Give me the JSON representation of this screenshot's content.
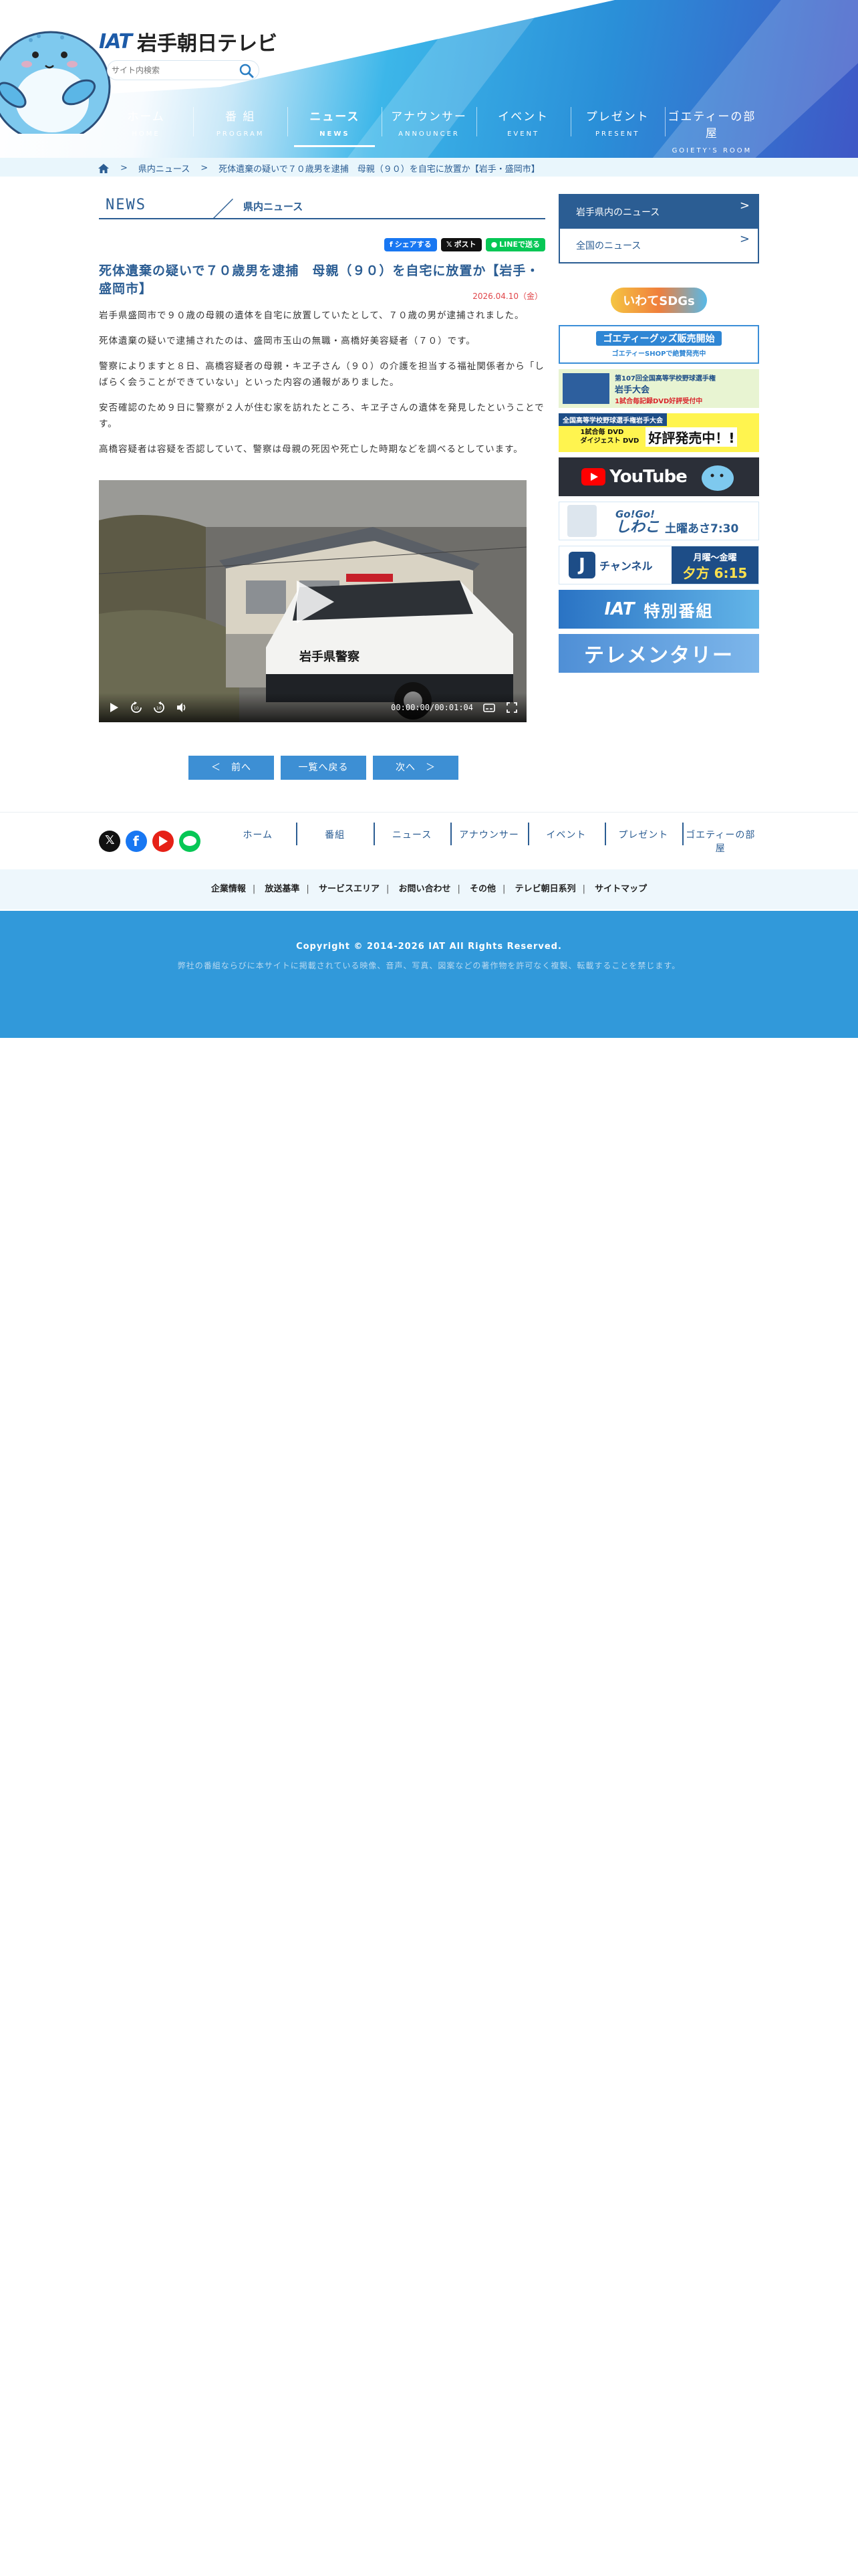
{
  "header": {
    "logo_mark": "IAT",
    "logo_text": "岩手朝日テレビ",
    "search_placeholder": "サイト内検索"
  },
  "gnav": [
    {
      "jp": "ホーム",
      "en": "HOME"
    },
    {
      "jp": "番 組",
      "en": "PROGRAM"
    },
    {
      "jp": "ニュース",
      "en": "NEWS"
    },
    {
      "jp": "アナウンサー",
      "en": "ANNOUNCER"
    },
    {
      "jp": "イベント",
      "en": "EVENT"
    },
    {
      "jp": "プレゼント",
      "en": "PRESENT"
    },
    {
      "jp": "ゴエティーの部屋",
      "en": "GOIETY'S ROOM"
    }
  ],
  "breadcrumb": {
    "sep": ">",
    "level1": "県内ニュース",
    "level2": "死体遺棄の疑いで７０歳男を逮捕　母親（９０）を自宅に放置か【岩手・盛岡市】"
  },
  "article": {
    "section_en": "NEWS",
    "section_slash": "／",
    "section_cat": "県内ニュース",
    "share_fb": "シェアする",
    "share_x": "ポスト",
    "share_line": "LINEで送る",
    "title": "死体遺棄の疑いで７０歳男を逮捕　母親（９０）を自宅に放置か【岩手・盛岡市】",
    "date": "2026.04.10（金）",
    "paragraphs": [
      "岩手県盛岡市で９０歳の母親の遺体を自宅に放置していたとして、７０歳の男が逮捕されました。",
      "死体遺棄の疑いで逮捕されたのは、盛岡市玉山の無職・高橋好美容疑者（７０）です。",
      "警察によりますと８日、高橋容疑者の母親・キヱ子さん（９０）の介護を担当する福祉関係者から「しばらく会うことができていない」といった内容の通報がありました。",
      "安否確認のため９日に警察が２人が住む家を訪れたところ、キヱ子さんの遺体を発見したということです。",
      "高橋容疑者は容疑を否認していて、警察は母親の死因や死亡した時期などを調べるとしています。"
    ],
    "video_time": "00:00:00/00:01:04",
    "video_car_text": "岩手県警察"
  },
  "pager": {
    "prev": "＜　前へ",
    "list": "一覧へ戻る",
    "next": "次へ　＞"
  },
  "sidebar": {
    "tab_local": "岩手県内のニュース",
    "tab_national": "全国のニュース",
    "arrow": ">",
    "banners": {
      "b1": "いわてSDGs",
      "b2a": "ゴエティーグッズ販売開始",
      "b2b": "ゴエティーSHOPで絶賛発売中",
      "b3a": "第107回全国高等学校野球選手権",
      "b3b": "岩手大会",
      "b3c": "1試合毎記録DVD好評受付中",
      "b4a": "全国高等学校野球選手権岩手大会",
      "b4b": "1試合毎 DVD",
      "b4c": "ダイジェスト DVD",
      "b4d": "好評発売中！!",
      "b5": "YouTube",
      "b6a": "Go!Go!",
      "b6b": "しわこ",
      "b6c": "土曜あさ7:30",
      "b7a": "チャンネル",
      "b7b": "月曜～金曜",
      "b7c": "夕方 6:15",
      "b8": "特別番組",
      "b9": "テレメンタリー"
    }
  },
  "footer_nav": [
    "ホーム",
    "番組",
    "ニュース",
    "アナウンサー",
    "イベント",
    "プレゼント",
    "ゴエティーの部屋"
  ],
  "footer_links": [
    "企業情報",
    "放送基準",
    "サービスエリア",
    "お問い合わせ",
    "その他",
    "テレビ朝日系列",
    "サイトマップ"
  ],
  "footer_sep": "|",
  "copyright": "Copyright © 2014-2026 IAT All Rights Reserved.",
  "copyright_note": "弊社の番組ならびに本サイトに掲載されている映像、音声、写真、図案などの著作物を許可なく複製、転載することを禁じます。",
  "colors": {
    "brand": "#2b5d93",
    "accent": "#3199da",
    "date": "#e0464a"
  }
}
